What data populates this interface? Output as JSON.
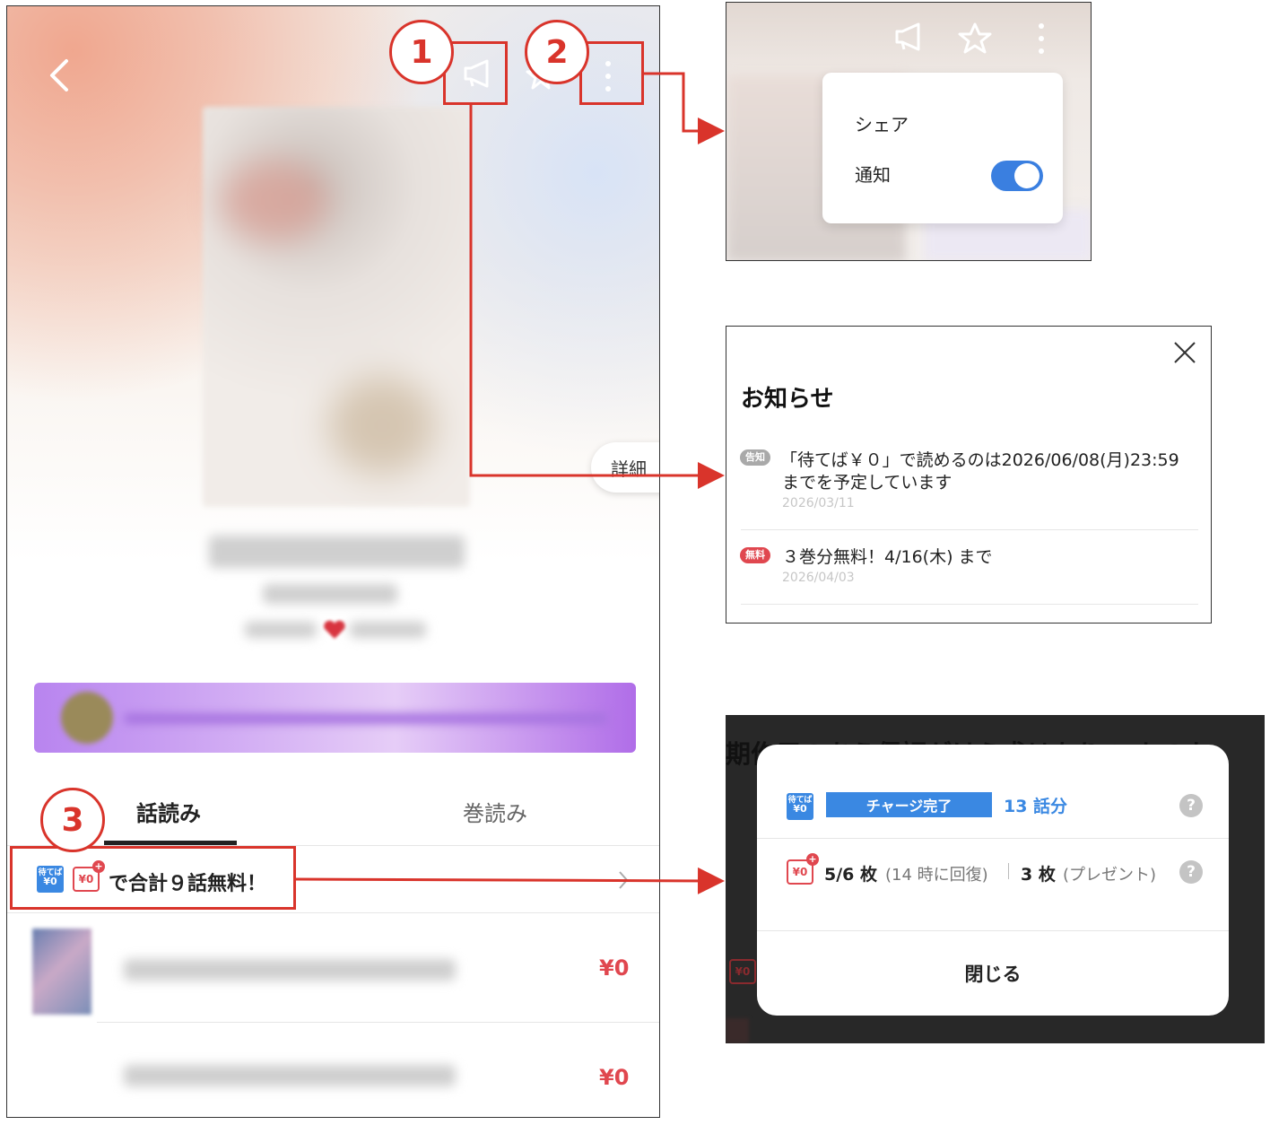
{
  "phone": {
    "detail_label": "詳細",
    "tabs": [
      {
        "label": "話読み",
        "active": true
      },
      {
        "label": "巻読み",
        "active": false
      }
    ],
    "wait_badge_line1": "待てば",
    "wait_badge_line2": "¥0",
    "yen_badge": "¥0",
    "yen_badge_plus": "+",
    "free_text": "で合計９話無料！",
    "episodes": [
      {
        "price": "¥0"
      },
      {
        "price": "¥0"
      }
    ]
  },
  "annotations": {
    "markers": [
      "1",
      "2",
      "3"
    ],
    "color": "#d9342b"
  },
  "menu_panel": {
    "share_label": "シェア",
    "notify_label": "通知",
    "notify_on": true,
    "toggle_color": "#3a7fe0"
  },
  "notice_panel": {
    "title": "お知らせ",
    "items": [
      {
        "tag": "告知",
        "tag_color": "#a9a9a9",
        "text_line1": "「待てば￥０」で読めるのは2026/06/08(月)23:59",
        "text_line2": "までを予定しています",
        "date": "2026/03/11"
      },
      {
        "tag": "無料",
        "tag_color": "#e0474f",
        "text_line1": "３巻分無料！4/16(木) まで",
        "date": "2026/04/03"
      }
    ]
  },
  "charge_panel": {
    "bg_text": "期作用のあう保証がけら求はなり いかのた",
    "charge_label": "チャージ完了",
    "charge_count": "13 話分",
    "ticket_count": "5/6 枚",
    "ticket_recovery": "(14 時に回復)",
    "present_count": "3 枚",
    "present_label": "(プレゼント)",
    "close_label": "閉じる",
    "help_glyph": "?"
  }
}
